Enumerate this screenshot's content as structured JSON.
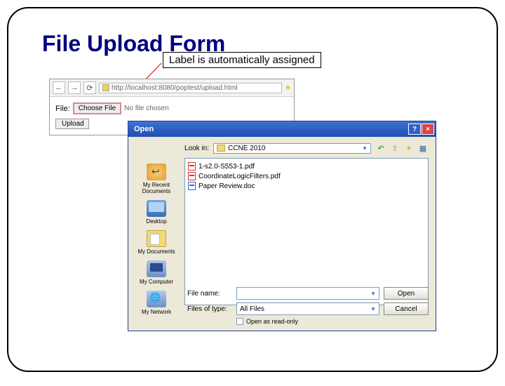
{
  "slide": {
    "title": "File Upload Form",
    "callout": "Label is automatically assigned"
  },
  "browser": {
    "url": "http://localhost:8080/poptest/upload.html",
    "back": "←",
    "forward": "→",
    "reload": "⟳"
  },
  "page": {
    "file_label": "File:",
    "choose_label": "Choose File",
    "no_file": "No file chosen",
    "upload_label": "Upload"
  },
  "dialog": {
    "title": "Open",
    "lookin_label": "Look in:",
    "folder": "CCNE 2010",
    "places": {
      "recent": "My Recent Documents",
      "desktop": "Desktop",
      "docs": "My Documents",
      "computer": "My Computer",
      "network": "My Network"
    },
    "files": [
      {
        "name": "1-s2.0-S553-1.pdf",
        "type": "pdf"
      },
      {
        "name": "CoordinateLogicFilters.pdf",
        "type": "pdf"
      },
      {
        "name": "Paper Review.doc",
        "type": "doc"
      }
    ],
    "filename_label": "File name:",
    "filetype_label": "Files of type:",
    "filetype_value": "All Files",
    "open_btn": "Open",
    "cancel_btn": "Cancel",
    "readonly_label": "Open as read-only"
  }
}
